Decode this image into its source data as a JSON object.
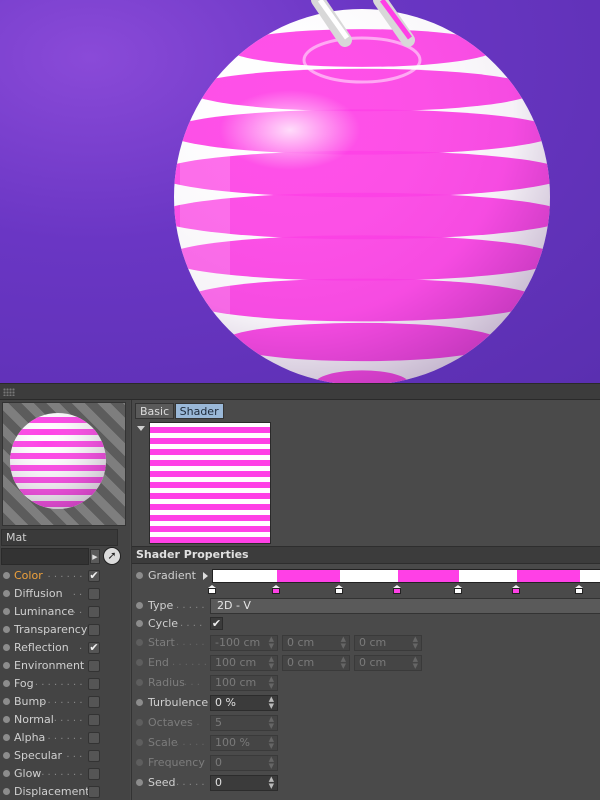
{
  "colors": {
    "magenta": "#ff40e6",
    "white": "#ffffff",
    "orange_active": "#f0a23c",
    "tab_active": "#9ab8d8"
  },
  "material": {
    "name": "Mat"
  },
  "channels": [
    {
      "label": "Color",
      "checked": true,
      "active": true
    },
    {
      "label": "Diffusion",
      "checked": false
    },
    {
      "label": "Luminance",
      "checked": false
    },
    {
      "label": "Transparency",
      "checked": false
    },
    {
      "label": "Reflection",
      "checked": true
    },
    {
      "label": "Environment",
      "checked": false
    },
    {
      "label": "Fog",
      "checked": false
    },
    {
      "label": "Bump",
      "checked": false
    },
    {
      "label": "Normal",
      "checked": false
    },
    {
      "label": "Alpha",
      "checked": false
    },
    {
      "label": "Specular",
      "checked": false
    },
    {
      "label": "Glow",
      "checked": false
    },
    {
      "label": "Displacement",
      "checked": false
    }
  ],
  "tabs": [
    {
      "label": "Basic",
      "active": false
    },
    {
      "label": "Shader",
      "active": true
    }
  ],
  "section": {
    "title": "Shader Properties"
  },
  "params": {
    "gradient": {
      "label": "Gradient"
    },
    "type": {
      "label": "Type",
      "value": "2D - V"
    },
    "cycle": {
      "label": "Cycle",
      "checked": true
    },
    "start": {
      "label": "Start",
      "values": [
        "-100 cm",
        "0 cm",
        "0 cm"
      ]
    },
    "end": {
      "label": "End",
      "values": [
        "100 cm",
        "0 cm",
        "0 cm"
      ]
    },
    "radius": {
      "label": "Radius",
      "value": "100 cm"
    },
    "turbulence": {
      "label": "Turbulence",
      "value": "0 %"
    },
    "octaves": {
      "label": "Octaves",
      "value": "5"
    },
    "scale": {
      "label": "Scale",
      "value": "100 %"
    },
    "frequency": {
      "label": "Frequency",
      "value": "0"
    },
    "seed": {
      "label": "Seed",
      "value": "0"
    }
  }
}
